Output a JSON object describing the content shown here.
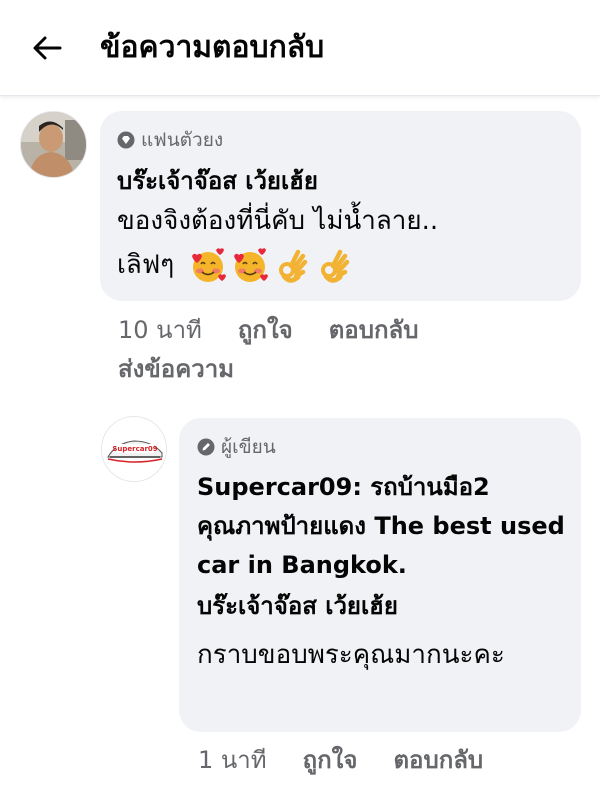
{
  "header": {
    "title": "ข้อความตอบกลับ"
  },
  "comments": [
    {
      "badge": "แฟนตัวยง",
      "author": "บร๊ะเจ้าจ๊อส เว้ยเฮ้ย",
      "text_line1": "ของจิงต้องที่นี่คับ ไม่น้ำลาย..",
      "text_line2": "เลิฟๆ",
      "emojis": [
        "smiling-face-with-hearts",
        "smiling-face-with-hearts",
        "ok-hand",
        "ok-hand"
      ],
      "time": "10 นาที",
      "like_label": "ถูกใจ",
      "reply_label": "ตอบกลับ",
      "message_label": "ส่งข้อความ"
    },
    {
      "badge": "ผู้เขียน",
      "author": "Supercar09: รถบ้านมือ2 คุณภาพป้ายแดง The best used car in Bangkok.",
      "mention": "บร๊ะเจ้าจ๊อส เว้ยเฮ้ย",
      "text": "กราบขอบพระคุณมากนะคะ",
      "time": "1 นาที",
      "like_label": "ถูกใจ",
      "reply_label": "ตอบกลับ",
      "logo_text": "Supercar09"
    }
  ],
  "colors": {
    "bubble": "#f0f2f5",
    "secondary_text": "#65676b",
    "primary_text": "#050505",
    "logo_red": "#d8232a"
  }
}
